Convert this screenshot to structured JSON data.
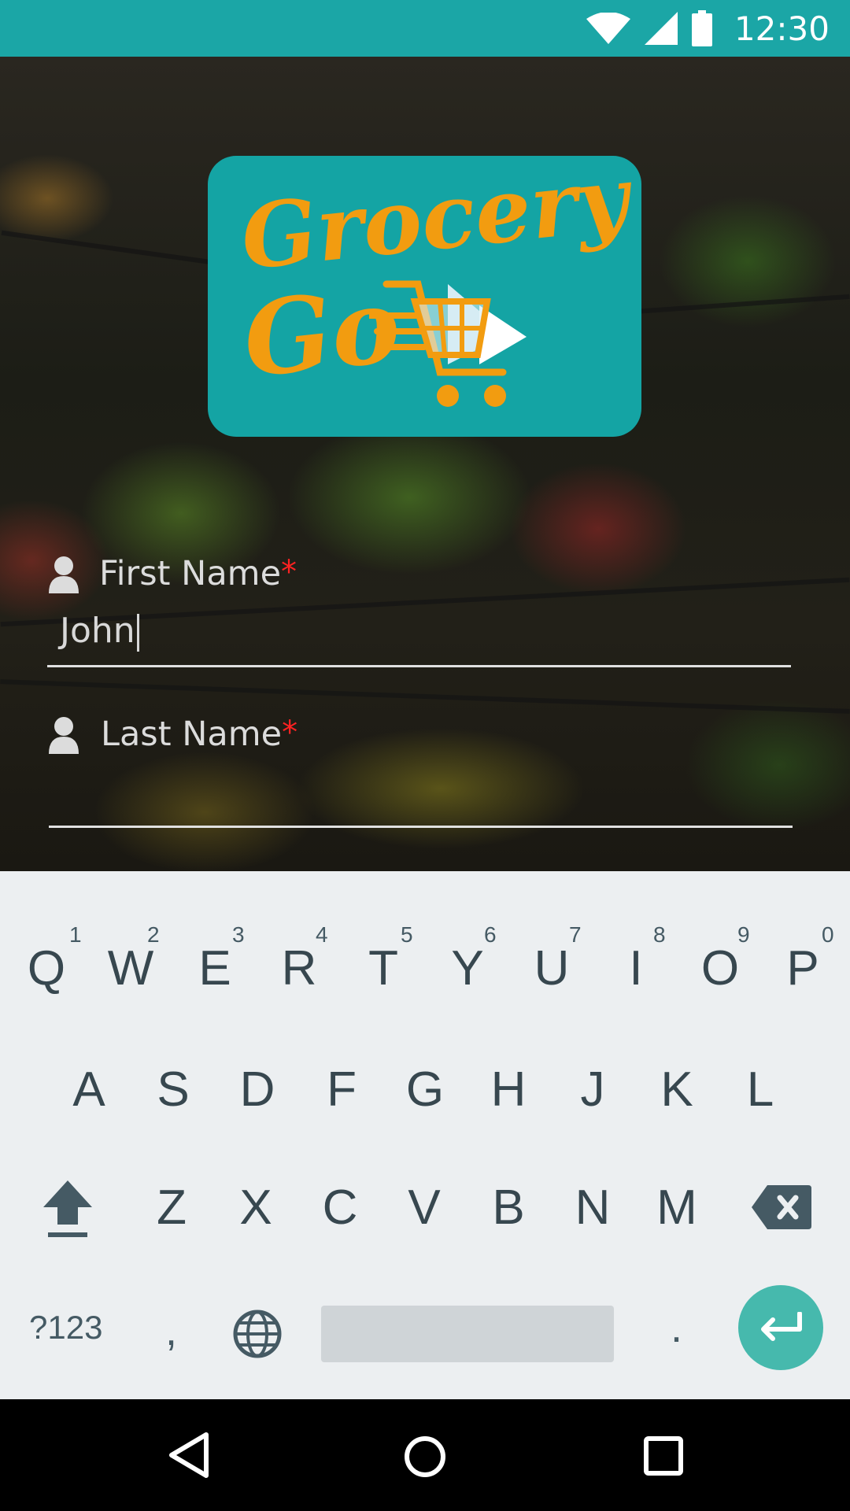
{
  "status_bar": {
    "time": "12:30",
    "icons": [
      "wifi-icon",
      "cell-signal-icon",
      "battery-icon"
    ]
  },
  "logo": {
    "line1": "Grocery",
    "line2": "Go",
    "background": "#14a4a4",
    "text_color": "#f29c10",
    "icon": "shopping-cart-icon"
  },
  "form": {
    "first_name": {
      "label": "First Name",
      "required_mark": "*",
      "value": "John",
      "icon": "person-icon"
    },
    "last_name": {
      "label": "Last Name",
      "required_mark": "*",
      "value": "",
      "icon": "person-icon"
    }
  },
  "keyboard": {
    "row1": [
      "Q",
      "W",
      "E",
      "R",
      "T",
      "Y",
      "U",
      "I",
      "O",
      "P"
    ],
    "row1_hints": [
      "1",
      "2",
      "3",
      "4",
      "5",
      "6",
      "7",
      "8",
      "9",
      "0"
    ],
    "row2": [
      "A",
      "S",
      "D",
      "F",
      "G",
      "H",
      "J",
      "K",
      "L"
    ],
    "row3": [
      "Z",
      "X",
      "C",
      "V",
      "B",
      "N",
      "M"
    ],
    "symbols_label": "?123",
    "comma": ",",
    "period": ".",
    "accent": "#46b9ad",
    "icons": [
      "shift-icon",
      "backspace-icon",
      "globe-icon",
      "enter-icon"
    ]
  },
  "nav_bar": {
    "icons": [
      "back-icon",
      "home-icon",
      "recents-icon"
    ]
  }
}
